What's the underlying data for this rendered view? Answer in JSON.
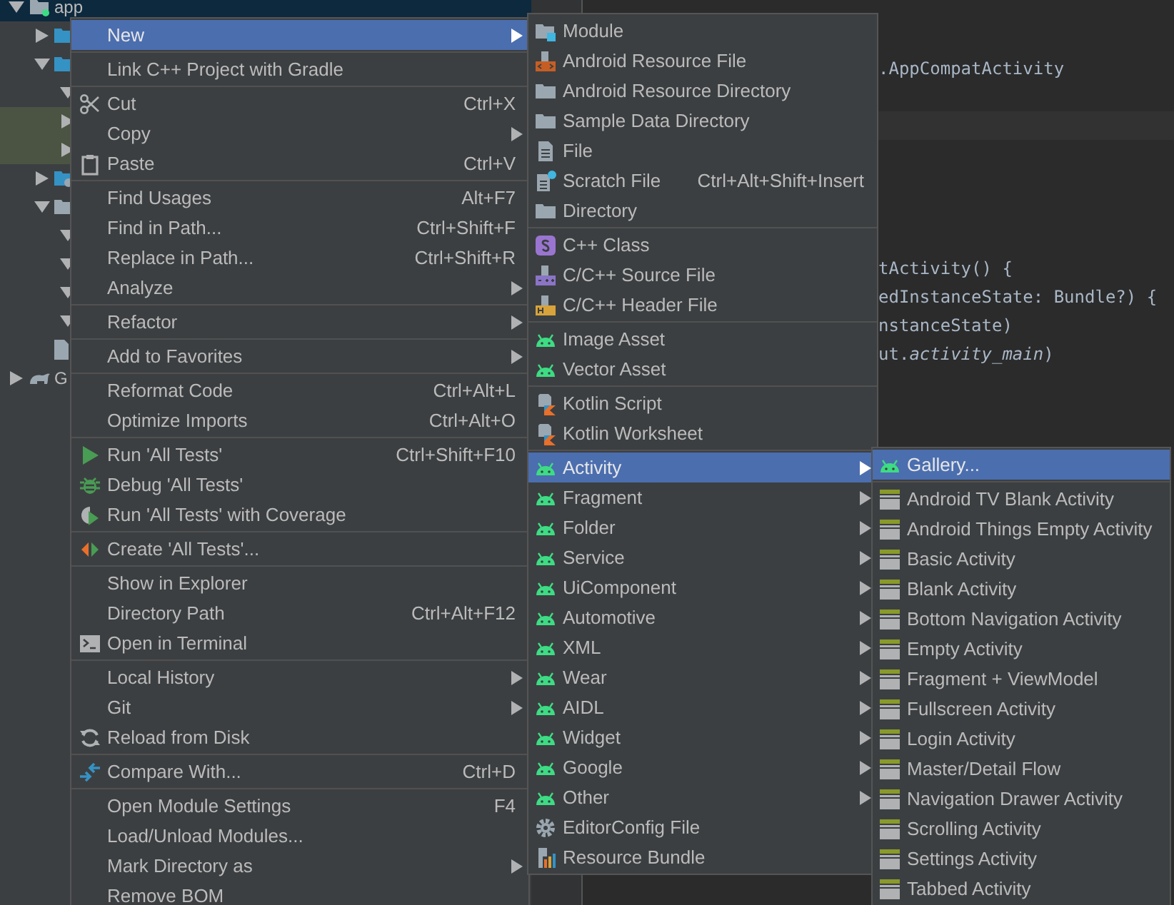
{
  "tree": [
    {
      "kind": "module",
      "label": "app",
      "expanded": true,
      "selected": true,
      "highlighted": false,
      "children": [
        {
          "kind": "folder-blue",
          "expanded": false,
          "selected": false,
          "highlighted": false
        },
        {
          "kind": "folder-blue",
          "expanded": true,
          "selected": false,
          "highlighted": false,
          "children": [
            {
              "expanded": true,
              "selected": false,
              "highlighted": false
            },
            {
              "expanded": false,
              "selected": false,
              "highlighted": true
            },
            {
              "expanded": false,
              "selected": false,
              "highlighted": true
            }
          ]
        },
        {
          "kind": "folder-source",
          "expanded": false,
          "selected": false,
          "highlighted": false
        },
        {
          "kind": "folder-grey",
          "expanded": true,
          "selected": false,
          "highlighted": false,
          "children": [
            {
              "expanded": true,
              "selected": false,
              "highlighted": false
            },
            {
              "expanded": true,
              "selected": false,
              "highlighted": false
            },
            {
              "expanded": true,
              "selected": false,
              "highlighted": false
            },
            {
              "expanded": true,
              "selected": false,
              "highlighted": false
            }
          ]
        },
        {
          "kind": "file",
          "selected": false,
          "highlighted": false
        }
      ]
    },
    {
      "kind": "gradle",
      "label": "G",
      "expanded": false,
      "selected": false,
      "highlighted": false
    }
  ],
  "editor": {
    "lines": [
      {
        "kind": "blank",
        "current": false
      },
      {
        "kind": "blank",
        "current": false
      },
      {
        "kind": "partial",
        "text": ".AppCompatActivity",
        "current": false
      },
      {
        "kind": "blank",
        "current": false
      },
      {
        "kind": "blank",
        "current": true
      },
      {
        "kind": "blank",
        "current": false
      },
      {
        "kind": "blank",
        "current": false
      },
      {
        "kind": "blank",
        "current": false
      },
      {
        "kind": "blank",
        "current": false
      },
      {
        "kind": "partial",
        "text": "tActivity() {",
        "current": false
      },
      {
        "kind": "partial",
        "text": "edInstanceState: Bundle?) {",
        "current": false
      },
      {
        "kind": "partial",
        "text": "nstanceState)",
        "current": false
      },
      {
        "kind": "partial",
        "text": "ut.*activity_main*)",
        "current": false
      }
    ]
  },
  "context_menu": {
    "items": [
      {
        "kind": "plain",
        "label": "New",
        "selected": true,
        "has_submenu": true
      },
      {
        "kind": "separator"
      },
      {
        "kind": "plain",
        "label": "Link C++ Project with Gradle",
        "selected": false,
        "has_submenu": false
      },
      {
        "kind": "separator"
      },
      {
        "kind": "scissors",
        "label": "Cut",
        "shortcut": "Ctrl+X",
        "selected": false,
        "has_submenu": false
      },
      {
        "kind": "plain",
        "label": "Copy",
        "selected": false,
        "has_submenu": true
      },
      {
        "kind": "clipboard",
        "label": "Paste",
        "shortcut": "Ctrl+V",
        "selected": false,
        "has_submenu": false
      },
      {
        "kind": "separator"
      },
      {
        "kind": "plain",
        "label": "Find Usages",
        "shortcut": "Alt+F7",
        "selected": false,
        "has_submenu": false
      },
      {
        "kind": "plain",
        "label": "Find in Path...",
        "shortcut": "Ctrl+Shift+F",
        "selected": false,
        "has_submenu": false
      },
      {
        "kind": "plain",
        "label": "Replace in Path...",
        "shortcut": "Ctrl+Shift+R",
        "selected": false,
        "has_submenu": false
      },
      {
        "kind": "plain",
        "label": "Analyze",
        "selected": false,
        "has_submenu": true
      },
      {
        "kind": "separator"
      },
      {
        "kind": "plain",
        "label": "Refactor",
        "selected": false,
        "has_submenu": true
      },
      {
        "kind": "separator"
      },
      {
        "kind": "plain",
        "label": "Add to Favorites",
        "selected": false,
        "has_submenu": true
      },
      {
        "kind": "separator"
      },
      {
        "kind": "plain",
        "label": "Reformat Code",
        "shortcut": "Ctrl+Alt+L",
        "selected": false,
        "has_submenu": false
      },
      {
        "kind": "plain",
        "label": "Optimize Imports",
        "shortcut": "Ctrl+Alt+O",
        "selected": false,
        "has_submenu": false
      },
      {
        "kind": "separator"
      },
      {
        "kind": "run",
        "label": "Run 'All Tests'",
        "shortcut": "Ctrl+Shift+F10",
        "selected": false,
        "has_submenu": false
      },
      {
        "kind": "bug",
        "label": "Debug 'All Tests'",
        "selected": false,
        "has_submenu": false
      },
      {
        "kind": "coverage",
        "label": "Run 'All Tests' with Coverage",
        "selected": false,
        "has_submenu": false
      },
      {
        "kind": "separator"
      },
      {
        "kind": "create-test",
        "label": "Create 'All Tests'...",
        "selected": false,
        "has_submenu": false
      },
      {
        "kind": "separator"
      },
      {
        "kind": "plain",
        "label": "Show in Explorer",
        "selected": false,
        "has_submenu": false
      },
      {
        "kind": "plain",
        "label": "Directory Path",
        "shortcut": "Ctrl+Alt+F12",
        "selected": false,
        "has_submenu": false
      },
      {
        "kind": "terminal",
        "label": "Open in Terminal",
        "selected": false,
        "has_submenu": false
      },
      {
        "kind": "separator"
      },
      {
        "kind": "plain",
        "label": "Local History",
        "selected": false,
        "has_submenu": true
      },
      {
        "kind": "plain",
        "label": "Git",
        "selected": false,
        "has_submenu": true
      },
      {
        "kind": "reload",
        "label": "Reload from Disk",
        "selected": false,
        "has_submenu": false
      },
      {
        "kind": "separator"
      },
      {
        "kind": "compare",
        "label": "Compare With...",
        "shortcut": "Ctrl+D",
        "selected": false,
        "has_submenu": false
      },
      {
        "kind": "separator"
      },
      {
        "kind": "plain",
        "label": "Open Module Settings",
        "shortcut": "F4",
        "selected": false,
        "has_submenu": false
      },
      {
        "kind": "plain",
        "label": "Load/Unload Modules...",
        "selected": false,
        "has_submenu": false
      },
      {
        "kind": "plain",
        "label": "Mark Directory as",
        "selected": false,
        "has_submenu": true
      },
      {
        "kind": "plain",
        "label": "Remove BOM",
        "selected": false,
        "has_submenu": false
      }
    ]
  },
  "new_menu": {
    "items": [
      {
        "kind": "module",
        "label": "Module",
        "selected": false,
        "has_submenu": false
      },
      {
        "kind": "resource-file",
        "label": "Android Resource File",
        "selected": false,
        "has_submenu": false
      },
      {
        "kind": "folder",
        "label": "Android Resource Directory",
        "selected": false,
        "has_submenu": false
      },
      {
        "kind": "folder",
        "label": "Sample Data Directory",
        "selected": false,
        "has_submenu": false
      },
      {
        "kind": "file",
        "label": "File",
        "selected": false,
        "has_submenu": false
      },
      {
        "kind": "scratch",
        "label": "Scratch File",
        "shortcut": "Ctrl+Alt+Shift+Insert",
        "selected": false,
        "has_submenu": false
      },
      {
        "kind": "folder",
        "label": "Directory",
        "selected": false,
        "has_submenu": false
      },
      {
        "kind": "separator"
      },
      {
        "kind": "cpp-class",
        "label": "C++ Class",
        "selected": false,
        "has_submenu": false
      },
      {
        "kind": "cpp-source",
        "label": "C/C++ Source File",
        "selected": false,
        "has_submenu": false
      },
      {
        "kind": "cpp-header",
        "label": "C/C++ Header File",
        "selected": false,
        "has_submenu": false
      },
      {
        "kind": "separator"
      },
      {
        "kind": "android",
        "label": "Image Asset",
        "selected": false,
        "has_submenu": false
      },
      {
        "kind": "android",
        "label": "Vector Asset",
        "selected": false,
        "has_submenu": false
      },
      {
        "kind": "separator"
      },
      {
        "kind": "kotlin",
        "label": "Kotlin Script",
        "selected": false,
        "has_submenu": false
      },
      {
        "kind": "kotlin",
        "label": "Kotlin Worksheet",
        "selected": false,
        "has_submenu": false
      },
      {
        "kind": "separator"
      },
      {
        "kind": "android",
        "label": "Activity",
        "selected": true,
        "has_submenu": true
      },
      {
        "kind": "android",
        "label": "Fragment",
        "selected": false,
        "has_submenu": true
      },
      {
        "kind": "android",
        "label": "Folder",
        "selected": false,
        "has_submenu": true
      },
      {
        "kind": "android",
        "label": "Service",
        "selected": false,
        "has_submenu": true
      },
      {
        "kind": "android",
        "label": "UiComponent",
        "selected": false,
        "has_submenu": true
      },
      {
        "kind": "android",
        "label": "Automotive",
        "selected": false,
        "has_submenu": true
      },
      {
        "kind": "android",
        "label": "XML",
        "selected": false,
        "has_submenu": true
      },
      {
        "kind": "android",
        "label": "Wear",
        "selected": false,
        "has_submenu": true
      },
      {
        "kind": "android",
        "label": "AIDL",
        "selected": false,
        "has_submenu": true
      },
      {
        "kind": "android",
        "label": "Widget",
        "selected": false,
        "has_submenu": true
      },
      {
        "kind": "android",
        "label": "Google",
        "selected": false,
        "has_submenu": true
      },
      {
        "kind": "android",
        "label": "Other",
        "selected": false,
        "has_submenu": true
      },
      {
        "kind": "gear",
        "label": "EditorConfig File",
        "selected": false,
        "has_submenu": false
      },
      {
        "kind": "bundle",
        "label": "Resource Bundle",
        "selected": false,
        "has_submenu": false
      }
    ]
  },
  "activity_menu": {
    "items": [
      {
        "kind": "android",
        "label": "Gallery...",
        "selected": true,
        "has_submenu": false
      },
      {
        "kind": "separator"
      },
      {
        "kind": "template",
        "label": "Android TV Blank Activity",
        "selected": false,
        "has_submenu": false
      },
      {
        "kind": "template",
        "label": "Android Things Empty Activity",
        "selected": false,
        "has_submenu": false
      },
      {
        "kind": "template",
        "label": "Basic Activity",
        "selected": false,
        "has_submenu": false
      },
      {
        "kind": "template",
        "label": "Blank Activity",
        "selected": false,
        "has_submenu": false
      },
      {
        "kind": "template",
        "label": "Bottom Navigation Activity",
        "selected": false,
        "has_submenu": false
      },
      {
        "kind": "template",
        "label": "Empty Activity",
        "selected": false,
        "has_submenu": false
      },
      {
        "kind": "template",
        "label": "Fragment + ViewModel",
        "selected": false,
        "has_submenu": false
      },
      {
        "kind": "template",
        "label": "Fullscreen Activity",
        "selected": false,
        "has_submenu": false
      },
      {
        "kind": "template",
        "label": "Login Activity",
        "selected": false,
        "has_submenu": false
      },
      {
        "kind": "template",
        "label": "Master/Detail Flow",
        "selected": false,
        "has_submenu": false
      },
      {
        "kind": "template",
        "label": "Navigation Drawer Activity",
        "selected": false,
        "has_submenu": false
      },
      {
        "kind": "template",
        "label": "Scrolling Activity",
        "selected": false,
        "has_submenu": false
      },
      {
        "kind": "template",
        "label": "Settings Activity",
        "selected": false,
        "has_submenu": false
      },
      {
        "kind": "template",
        "label": "Tabbed Activity",
        "selected": false,
        "has_submenu": false
      }
    ]
  }
}
